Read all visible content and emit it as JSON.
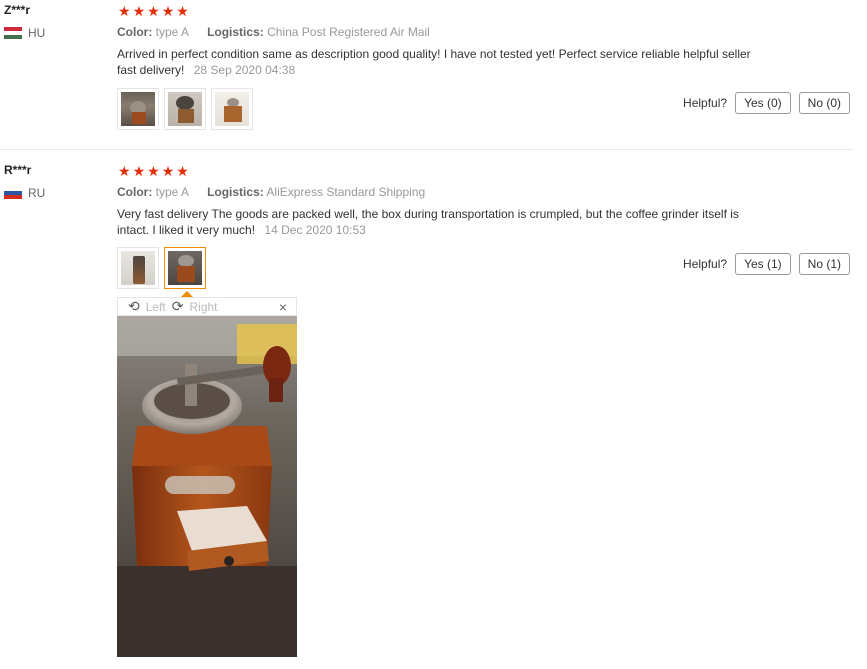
{
  "reviews": [
    {
      "user": "Z***r",
      "country": "HU",
      "color_label": "Color:",
      "color_value": "type A",
      "logistics_label": "Logistics:",
      "logistics_value": "China Post Registered Air Mail",
      "text": "Arrived in perfect condition same as description good quality! I have not tested yet! Perfect service reliable helpful seller fast delivery!",
      "date": "28 Sep 2020 04:38",
      "helpful_label": "Helpful?",
      "yes_label": "Yes (0)",
      "no_label": "No (0)"
    },
    {
      "user": "R***r",
      "country": "RU",
      "color_label": "Color:",
      "color_value": "type A",
      "logistics_label": "Logistics:",
      "logistics_value": "AliExpress Standard Shipping",
      "text": "Very fast delivery The goods are packed well, the box during transportation is crumpled, but the coffee grinder itself is intact. I liked it very much!",
      "date": "14 Dec 2020 10:53",
      "helpful_label": "Helpful?",
      "yes_label": "Yes (1)",
      "no_label": "No (1)"
    }
  ],
  "viewer": {
    "left_label": "Left",
    "right_label": "Right",
    "close_glyph": "×",
    "rotate_left_icon": "rotate-left-icon",
    "rotate_right_icon": "rotate-right-icon"
  },
  "rating": {
    "stars": 5,
    "color": "#e62e04"
  },
  "colors": {
    "accent": "#f08c00",
    "star": "#e62e04"
  }
}
